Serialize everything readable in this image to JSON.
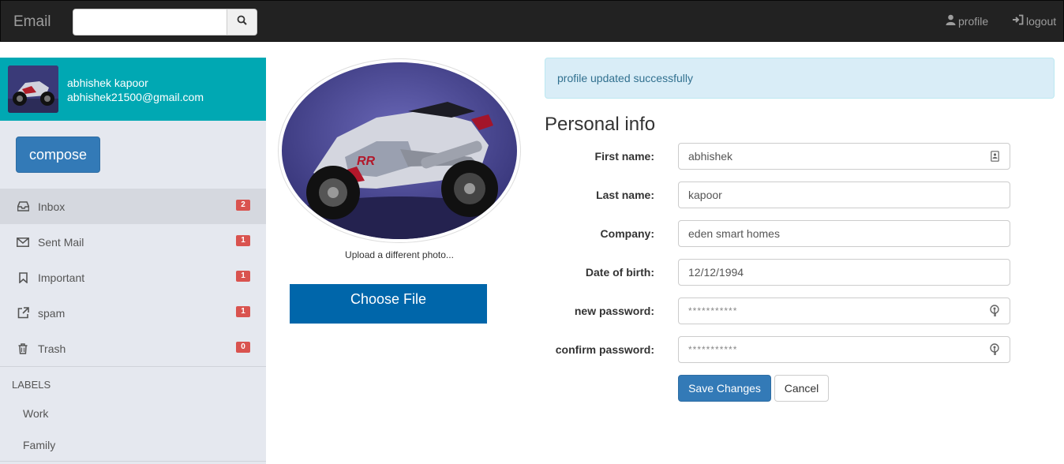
{
  "navbar": {
    "brand": "Email",
    "search": {
      "value": "",
      "placeholder": ""
    },
    "search_icon": "search-icon",
    "profile_label": "profile",
    "profile_icon": "user-icon",
    "logout_label": "logout",
    "logout_icon": "sign-in-icon"
  },
  "sidebar": {
    "user": {
      "name": "abhishek kapoor",
      "email": "abhishek21500@gmail.com"
    },
    "compose_label": "compose",
    "items": [
      {
        "label": "Inbox",
        "icon": "inbox-icon",
        "count": "2",
        "active": true
      },
      {
        "label": "Sent Mail",
        "icon": "envelope-icon",
        "count": "1",
        "active": false
      },
      {
        "label": "Important",
        "icon": "bookmark-icon",
        "count": "1",
        "active": false
      },
      {
        "label": "spam",
        "icon": "external-link-icon",
        "count": "1",
        "active": false
      },
      {
        "label": "Trash",
        "icon": "trash-icon",
        "count": "0",
        "active": false
      }
    ],
    "labels_heading": "LABELS",
    "labels": [
      "Work",
      "Family"
    ]
  },
  "photo": {
    "upload_text": "Upload a different photo...",
    "choose_file_label": "Choose File"
  },
  "alert": {
    "text": "profile updated successfully",
    "color": "#31708f"
  },
  "form": {
    "title": "Personal info",
    "fields": [
      {
        "label": "First name:",
        "value": "abhishek",
        "icon": "contact-card-icon"
      },
      {
        "label": "Last name:",
        "value": "kapoor"
      },
      {
        "label": "Company:",
        "value": "eden smart homes"
      },
      {
        "label": "Date of birth:",
        "value": "12/12/1994"
      },
      {
        "label": "new password:",
        "value": "***********",
        "icon": "key-icon"
      },
      {
        "label": "confirm password:",
        "value": "***********",
        "icon": "key-icon"
      }
    ],
    "save_label": "Save Changes",
    "cancel_label": "Cancel"
  },
  "colors": {
    "navbar_bg": "#222222",
    "sidebar_user_bg": "#00a8b3",
    "primary": "#337ab7",
    "choose_file_bg": "#0066aa",
    "badge": "#d9534f"
  }
}
